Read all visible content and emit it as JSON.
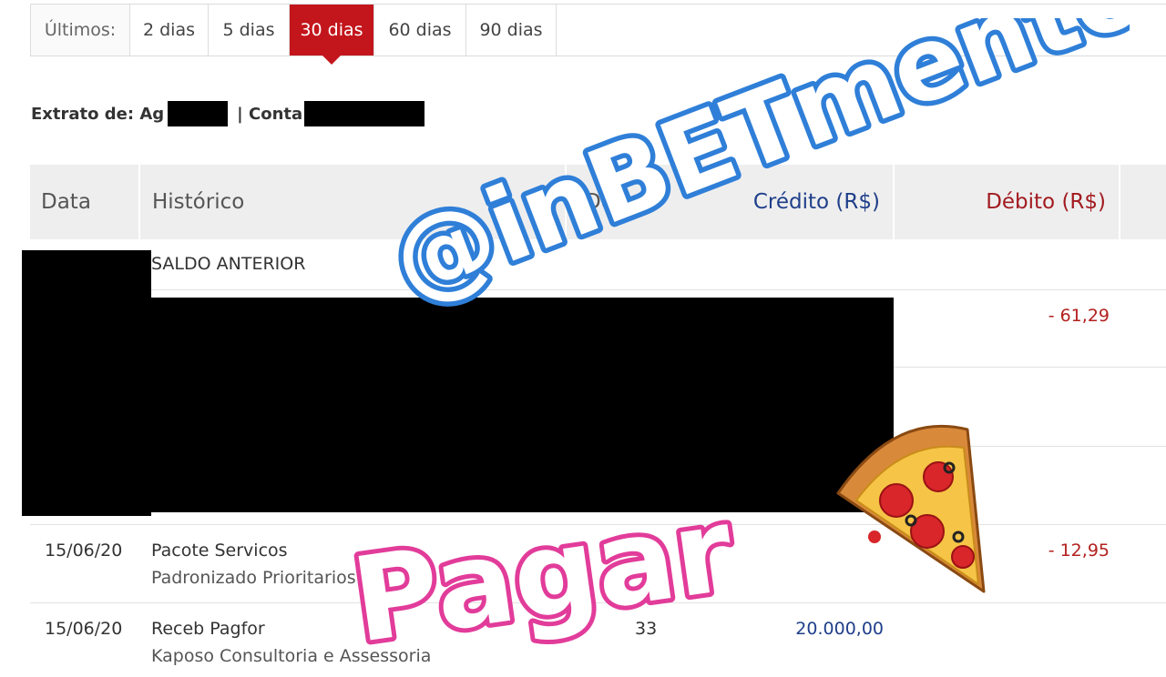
{
  "filter": {
    "label": "Últimos:",
    "options": [
      "2 dias",
      "5 dias",
      "30 dias",
      "60 dias",
      "90 dias"
    ],
    "selected": "30 dias"
  },
  "account": {
    "prefix": "Extrato de: Ag",
    "separator": "| Conta"
  },
  "table": {
    "headers": {
      "date": "Data",
      "history": "Histórico",
      "document": "Do",
      "credit": "Crédito (R$)",
      "debit": "Débito (R$)"
    },
    "rows": [
      {
        "history": "SALDO ANTERIOR"
      },
      {
        "debit": "- 61,29"
      },
      {
        "date": "15/06/20",
        "history": "Pacote Servicos",
        "history_detail": "Padronizado Prioritarios",
        "debit": "- 12,95"
      },
      {
        "date": "15/06/20",
        "history": "Receb Pagfor",
        "history_detail": "Kaposo Consultoria e Assessoria",
        "document": "33",
        "credit": "20.000,00"
      }
    ]
  },
  "overlay": {
    "handle": "@inBETmentos",
    "caption": "Pagar",
    "sticker_icon": "pizza-slice-icon",
    "colors": {
      "handle": "#2f7fd8",
      "caption": "#e23c9a",
      "bank_red": "#c3161c"
    }
  }
}
